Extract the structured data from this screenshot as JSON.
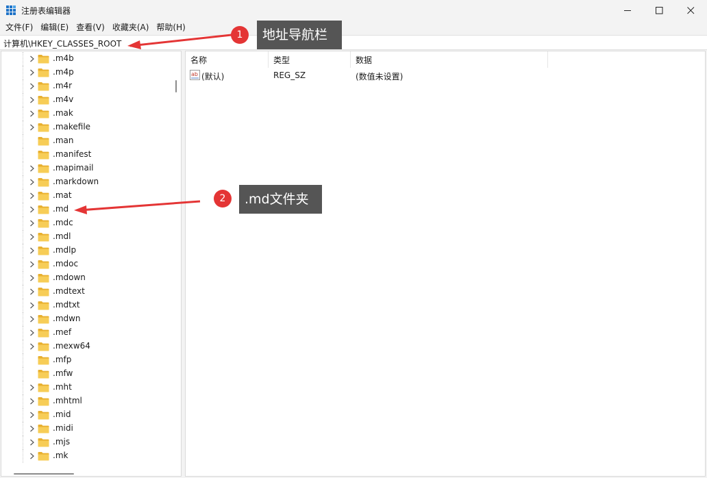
{
  "window": {
    "title": "注册表编辑器",
    "controls": {
      "minimize": "minimize-icon",
      "maximize": "maximize-icon",
      "close": "close-icon"
    }
  },
  "menu": [
    "文件(F)",
    "编辑(E)",
    "查看(V)",
    "收藏夹(A)",
    "帮助(H)"
  ],
  "address": {
    "path": "计算机\\HKEY_CLASSES_ROOT"
  },
  "tree": {
    "items": [
      {
        "label": ".m4b",
        "expandable": true
      },
      {
        "label": ".m4p",
        "expandable": true
      },
      {
        "label": ".m4r",
        "expandable": true
      },
      {
        "label": ".m4v",
        "expandable": true
      },
      {
        "label": ".mak",
        "expandable": true
      },
      {
        "label": ".makefile",
        "expandable": true
      },
      {
        "label": ".man",
        "expandable": false
      },
      {
        "label": ".manifest",
        "expandable": false
      },
      {
        "label": ".mapimail",
        "expandable": true
      },
      {
        "label": ".markdown",
        "expandable": true
      },
      {
        "label": ".mat",
        "expandable": true
      },
      {
        "label": ".md",
        "expandable": true
      },
      {
        "label": ".mdc",
        "expandable": true
      },
      {
        "label": ".mdl",
        "expandable": true
      },
      {
        "label": ".mdlp",
        "expandable": true
      },
      {
        "label": ".mdoc",
        "expandable": true
      },
      {
        "label": ".mdown",
        "expandable": true
      },
      {
        "label": ".mdtext",
        "expandable": true
      },
      {
        "label": ".mdtxt",
        "expandable": true
      },
      {
        "label": ".mdwn",
        "expandable": true
      },
      {
        "label": ".mef",
        "expandable": true
      },
      {
        "label": ".mexw64",
        "expandable": true
      },
      {
        "label": ".mfp",
        "expandable": false
      },
      {
        "label": ".mfw",
        "expandable": false
      },
      {
        "label": ".mht",
        "expandable": true
      },
      {
        "label": ".mhtml",
        "expandable": true
      },
      {
        "label": ".mid",
        "expandable": true
      },
      {
        "label": ".midi",
        "expandable": true
      },
      {
        "label": ".mjs",
        "expandable": true
      },
      {
        "label": ".mk",
        "expandable": true
      }
    ]
  },
  "values": {
    "columns": {
      "name": "名称",
      "type": "类型",
      "data": "数据"
    },
    "rows": [
      {
        "name": "(默认)",
        "type": "REG_SZ",
        "data": "(数值未设置)",
        "icon": "string-value-icon"
      }
    ]
  },
  "annotations": [
    {
      "number": "1",
      "text": "地址导航栏"
    },
    {
      "number": "2",
      "text": ".md文件夹"
    }
  ],
  "colors": {
    "callout_bg": "#555555",
    "badge": "#e43535",
    "arrow": "#e43535",
    "folder": "#f5c24b"
  }
}
